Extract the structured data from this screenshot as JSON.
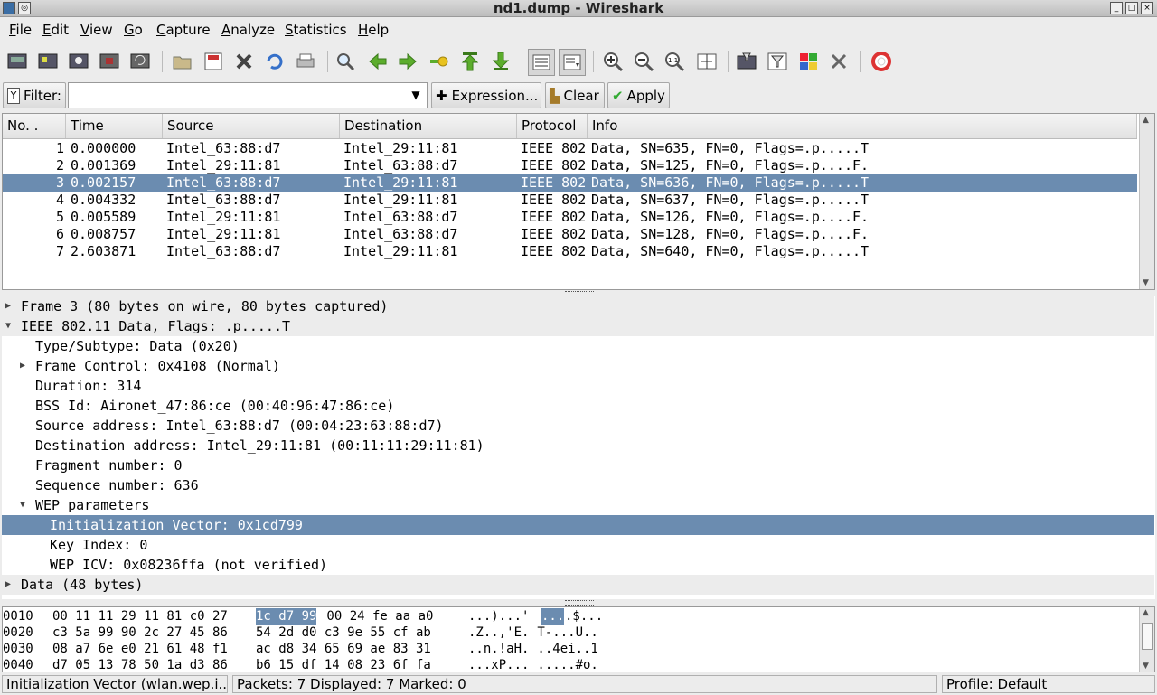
{
  "window": {
    "title": "nd1.dump - Wireshark"
  },
  "menu": [
    "File",
    "Edit",
    "View",
    "Go",
    "Capture",
    "Analyze",
    "Statistics",
    "Help"
  ],
  "toolbar_icons": [
    "interfaces-icon",
    "options-icon",
    "start-icon",
    "stop-icon",
    "restart-icon",
    "open-icon",
    "save-icon",
    "close-icon",
    "reload-icon",
    "print-icon",
    "find-icon",
    "back-icon",
    "forward-icon",
    "goto-icon",
    "first-icon",
    "last-icon",
    "colorize-icon",
    "autoscroll-icon",
    "zoom-in-icon",
    "zoom-out-icon",
    "normal-size-icon",
    "resize-columns-icon",
    "capture-filters-icon",
    "display-filters-icon",
    "coloring-rules-icon",
    "preferences-icon",
    "help-icon"
  ],
  "filter": {
    "label": "Filter:",
    "value": "",
    "expression": "Expression...",
    "clear": "Clear",
    "apply": "Apply"
  },
  "packet_list": {
    "columns": [
      "No. .",
      "Time",
      "Source",
      "Destination",
      "Protocol",
      "Info"
    ],
    "rows": [
      {
        "no": "1",
        "time": "0.000000",
        "src": "Intel_63:88:d7",
        "dst": "Intel_29:11:81",
        "proto": "IEEE 802",
        "info": "Data, SN=635, FN=0, Flags=.p.....T"
      },
      {
        "no": "2",
        "time": "0.001369",
        "src": "Intel_29:11:81",
        "dst": "Intel_63:88:d7",
        "proto": "IEEE 802",
        "info": "Data, SN=125, FN=0, Flags=.p....F."
      },
      {
        "no": "3",
        "time": "0.002157",
        "src": "Intel_63:88:d7",
        "dst": "Intel_29:11:81",
        "proto": "IEEE 802",
        "info": "Data, SN=636, FN=0, Flags=.p.....T"
      },
      {
        "no": "4",
        "time": "0.004332",
        "src": "Intel_63:88:d7",
        "dst": "Intel_29:11:81",
        "proto": "IEEE 802",
        "info": "Data, SN=637, FN=0, Flags=.p.....T"
      },
      {
        "no": "5",
        "time": "0.005589",
        "src": "Intel_29:11:81",
        "dst": "Intel_63:88:d7",
        "proto": "IEEE 802",
        "info": "Data, SN=126, FN=0, Flags=.p....F."
      },
      {
        "no": "6",
        "time": "0.008757",
        "src": "Intel_29:11:81",
        "dst": "Intel_63:88:d7",
        "proto": "IEEE 802",
        "info": "Data, SN=128, FN=0, Flags=.p....F."
      },
      {
        "no": "7",
        "time": "2.603871",
        "src": "Intel_63:88:d7",
        "dst": "Intel_29:11:81",
        "proto": "IEEE 802",
        "info": "Data, SN=640, FN=0, Flags=.p.....T"
      }
    ],
    "selected_index": 2
  },
  "details": [
    {
      "text": "Frame 3 (80 bytes on wire, 80 bytes captured)",
      "indent": 0,
      "toggle": "collapsed",
      "alt": true
    },
    {
      "text": "IEEE 802.11 Data, Flags: .p.....T",
      "indent": 0,
      "toggle": "expanded",
      "alt": true
    },
    {
      "text": "Type/Subtype: Data (0x20)",
      "indent": 1,
      "toggle": ""
    },
    {
      "text": "Frame Control: 0x4108 (Normal)",
      "indent": 1,
      "toggle": "collapsed"
    },
    {
      "text": "Duration: 314",
      "indent": 1,
      "toggle": ""
    },
    {
      "text": "BSS Id: Aironet_47:86:ce (00:40:96:47:86:ce)",
      "indent": 1,
      "toggle": ""
    },
    {
      "text": "Source address: Intel_63:88:d7 (00:04:23:63:88:d7)",
      "indent": 1,
      "toggle": ""
    },
    {
      "text": "Destination address: Intel_29:11:81 (00:11:11:29:11:81)",
      "indent": 1,
      "toggle": ""
    },
    {
      "text": "Fragment number: 0",
      "indent": 1,
      "toggle": ""
    },
    {
      "text": "Sequence number: 636",
      "indent": 1,
      "toggle": ""
    },
    {
      "text": "WEP parameters",
      "indent": 1,
      "toggle": "expanded"
    },
    {
      "text": "Initialization Vector: 0x1cd799",
      "indent": 2,
      "toggle": "",
      "selected": true
    },
    {
      "text": "Key Index: 0",
      "indent": 2,
      "toggle": ""
    },
    {
      "text": "WEP ICV: 0x08236ffa (not verified)",
      "indent": 2,
      "toggle": ""
    },
    {
      "text": "Data (48 bytes)",
      "indent": 0,
      "toggle": "collapsed",
      "alt": true
    }
  ],
  "hex": [
    {
      "off": "0010",
      "a": "00 11 11 29 11 81 c0 27",
      "b1": "1c d7 99",
      "b2": " 00 24 fe aa a0",
      "c1": "...)...'",
      "c2": " ",
      "c3": "...",
      "c4": ".$..."
    },
    {
      "off": "0020",
      "a": "c3 5a 99 90 2c 27 45 86",
      "b1": "",
      "b2": "54 2d d0 c3 9e 55 cf ab",
      "c1": ".Z..,'E.",
      "c2": " T-...U..",
      "c3": "",
      "c4": ""
    },
    {
      "off": "0030",
      "a": "08 a7 6e e0 21 61 48 f1",
      "b1": "",
      "b2": "ac d8 34 65 69 ae 83 31",
      "c1": "..n.!aH.",
      "c2": " ..4ei..1",
      "c3": "",
      "c4": ""
    },
    {
      "off": "0040",
      "a": "d7 05 13 78 50 1a d3 86",
      "b1": "",
      "b2": "b6 15 df 14 08 23 6f fa",
      "c1": "...xP...",
      "c2": " .....#o.",
      "c3": "",
      "c4": ""
    }
  ],
  "status": {
    "field": "Initialization Vector (wlan.wep.i...",
    "packets": "Packets: 7 Displayed: 7 Marked: 0",
    "profile": "Profile: Default"
  },
  "colors": {
    "selection": "#6b8cb0"
  }
}
